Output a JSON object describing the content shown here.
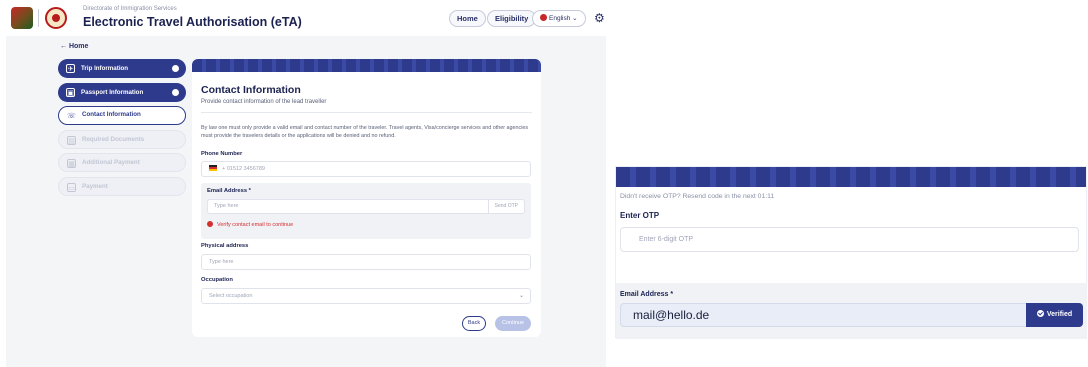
{
  "header": {
    "department": "Directorate of Immigration Services",
    "app_title": "Electronic Travel Authorisation (eTA)",
    "nav": {
      "home": "Home",
      "eligibility": "Eligibility"
    },
    "language": "English",
    "language_chevron": "⌄",
    "settings_icon": "⚙"
  },
  "back": {
    "label": "Home",
    "arrow": "←"
  },
  "steps": [
    {
      "label": "Trip Information",
      "icon": "✈",
      "state": "done"
    },
    {
      "label": "Passport Information",
      "icon": "▣",
      "state": "done"
    },
    {
      "label": "Contact Information",
      "icon": "☏",
      "state": "active"
    },
    {
      "label": "Required Documents",
      "icon": "▤",
      "state": "todo"
    },
    {
      "label": "Additional Payment",
      "icon": "▦",
      "state": "todo"
    },
    {
      "label": "Payment",
      "icon": "▭",
      "state": "todo"
    }
  ],
  "form": {
    "title": "Contact Information",
    "subtitle": "Provide contact information of the lead traveller",
    "note": "By law one must only provide a valid email and contact number of the traveler. Travel agents, Visa/concierge services and other agencies must provide the travelers details or the applications will be denied and no refund.",
    "phone": {
      "label": "Phone Number",
      "value": "+ 01512 3456789"
    },
    "email": {
      "label": "Email Address *",
      "placeholder": "Type here",
      "send_otp": "Send OTP",
      "error": "Verify contact email to continue"
    },
    "address": {
      "label": "Physical address",
      "placeholder": "Type here"
    },
    "occupation": {
      "label": "Occupation",
      "value": "Select occupation",
      "chevron": "⌄"
    },
    "buttons": {
      "back": "Back",
      "continue": "Continue"
    }
  },
  "zoom": {
    "resend_text": "Didn't receive OTP? Resend code in the next 01:11",
    "otp_label": "Enter OTP",
    "otp_placeholder": "Enter 6-digit OTP",
    "email_label": "Email Address *",
    "email_value": "mail@hello.de",
    "verified_label": "Verified"
  }
}
